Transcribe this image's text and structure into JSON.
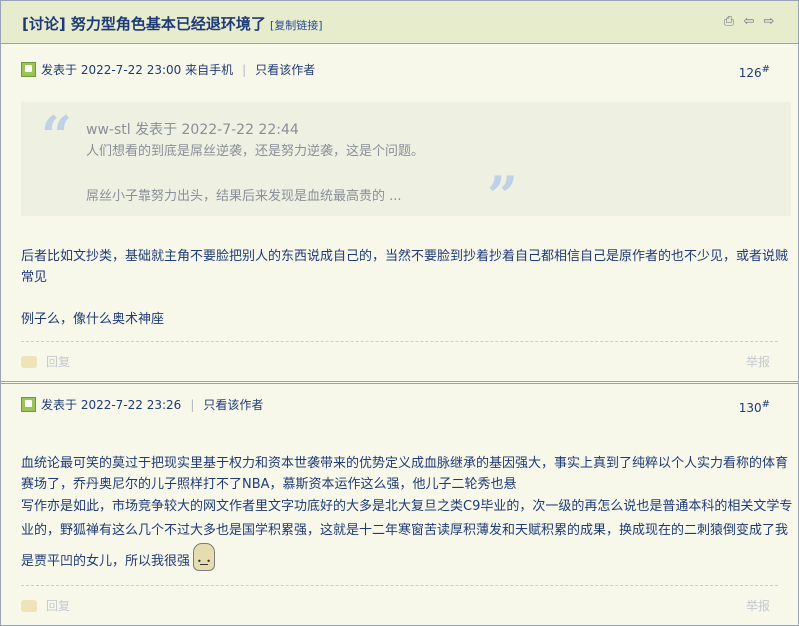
{
  "thread": {
    "title": "[讨论] 努力型角色基本已经退环境了",
    "copy_link": "[复制链接]"
  },
  "toolbar_icons": [
    "print-icon",
    "prev-thread-icon",
    "next-thread-icon"
  ],
  "posts": [
    {
      "posted_at": "发表于 2022-7-22 23:00 来自手机",
      "only_author": "只看该作者",
      "floor": "126",
      "floor_mark": "#",
      "quote": {
        "author_line": "ww-stl 发表于 2022-7-22 22:44",
        "line1": "人们想看的到底是屌丝逆袭，还是努力逆袭，这是个问题。",
        "line2": "屌丝小子靠努力出头，结果后来发现是血统最高贵的 ..."
      },
      "para1": "后者比如文抄类，基础就主角不要脸把别人的东西说成自己的，当然不要脸到抄着抄着自己都相信自己是原作者的也不少见，或者说贼常见",
      "para2": "例子么，像什么奥术神座",
      "reply": "回复",
      "report": "举报"
    },
    {
      "posted_at": "发表于 2022-7-22 23:26",
      "only_author": "只看该作者",
      "floor": "130",
      "floor_mark": "#",
      "para1": "血统论最可笑的莫过于把现实里基于权力和资本世袭带来的优势定义成血脉继承的基因强大，事实上真到了纯粹以个人实力看称的体育赛场了，乔丹奥尼尔的儿子照样打不了NBA，慕斯资本运作这么强，他儿子二轮秀也悬",
      "para2": "写作亦是如此，市场竞争较大的网文作者里文字功底好的大多是北大复旦之类C9毕业的，次一级的再怎么说也是普通本科的相关文学专业的，野狐禅有这么几个不过大多也是国学积累强，这就是十二年寒窗苦读厚积薄发和天赋积累的成果，换成现在的二刺猿倒变成了我是贾平凹的女儿，所以我很强",
      "reply": "回复",
      "report": "举报"
    }
  ]
}
